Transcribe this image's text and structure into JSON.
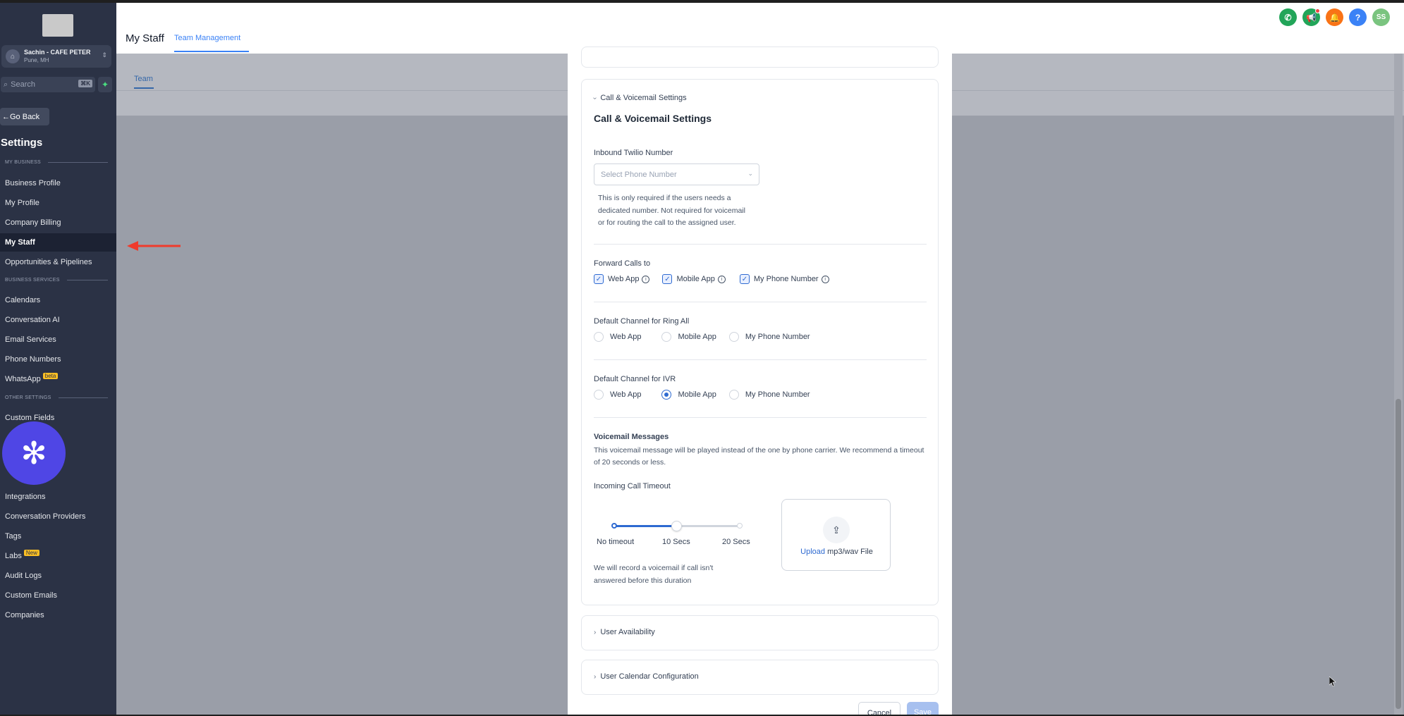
{
  "sidebar": {
    "account": {
      "name": "Sachin - CAFE PETER",
      "location": "Pune, MH"
    },
    "search": {
      "placeholder": "Search",
      "shortcut": "⌘K"
    },
    "go_back": "Go Back",
    "title": "Settings",
    "sections": {
      "my_business": "MY BUSINESS",
      "business_services": "BUSINESS SERVICES",
      "other_settings": "OTHER SETTINGS"
    },
    "items": [
      {
        "label": "Business Profile"
      },
      {
        "label": "My Profile"
      },
      {
        "label": "Company Billing"
      },
      {
        "label": "My Staff",
        "active": true
      },
      {
        "label": "Opportunities & Pipelines"
      },
      {
        "label": "Calendars"
      },
      {
        "label": "Conversation AI"
      },
      {
        "label": "Email Services"
      },
      {
        "label": "Phone Numbers"
      },
      {
        "label": "WhatsApp",
        "badge": "beta"
      },
      {
        "label": "Custom Fields"
      },
      {
        "label": "Integrations"
      },
      {
        "label": "Conversation Providers"
      },
      {
        "label": "Tags"
      },
      {
        "label": "Labs",
        "badge": "New"
      },
      {
        "label": "Audit Logs"
      },
      {
        "label": "Custom Emails"
      },
      {
        "label": "Companies"
      }
    ]
  },
  "header": {
    "title": "My Staff",
    "tab": "Team Management",
    "icons": [
      {
        "name": "phone-icon",
        "color": "#22a559"
      },
      {
        "name": "megaphone-icon",
        "color": "#22a559"
      },
      {
        "name": "bell-icon",
        "color": "#f97316"
      },
      {
        "name": "help-icon",
        "color": "#3b82f6",
        "glyph": "?"
      },
      {
        "name": "user-avatar",
        "color": "#7ac47f",
        "glyph": "SS"
      }
    ]
  },
  "subheader": {
    "tab": "Team"
  },
  "drawer": {
    "section_toggle": "Call & Voicemail Settings",
    "heading": "Call & Voicemail Settings",
    "inbound_label": "Inbound Twilio Number",
    "inbound_placeholder": "Select Phone Number",
    "inbound_help": "This is only required if the users needs a dedicated number. Not required for voicemail or for routing the call to the assigned user.",
    "forward_label": "Forward Calls to",
    "forward_options": [
      "Web App",
      "Mobile App",
      "My Phone Number"
    ],
    "ring_all_label": "Default Channel for Ring All",
    "ring_all_options": [
      "Web App",
      "Mobile App",
      "My Phone Number"
    ],
    "ivr_label": "Default Channel for IVR",
    "ivr_options": [
      "Web App",
      "Mobile App",
      "My Phone Number"
    ],
    "ivr_selected": "Mobile App",
    "voicemail_label": "Voicemail Messages",
    "voicemail_desc": "This voicemail message will be played instead of the one by phone carrier. We recommend a timeout of 20 seconds or less.",
    "timeout_label": "Incoming Call Timeout",
    "timeout_ticks": [
      "No timeout",
      "10 Secs",
      "20 Secs"
    ],
    "timeout_value_secs": 10,
    "timeout_note": "We will record a voicemail if call isn't answered before this duration",
    "upload_link": "Upload",
    "upload_text": "mp3/wav File",
    "user_availability": "User Availability",
    "user_calendar": "User Calendar Configuration",
    "cancel": "Cancel",
    "save": "Save"
  }
}
